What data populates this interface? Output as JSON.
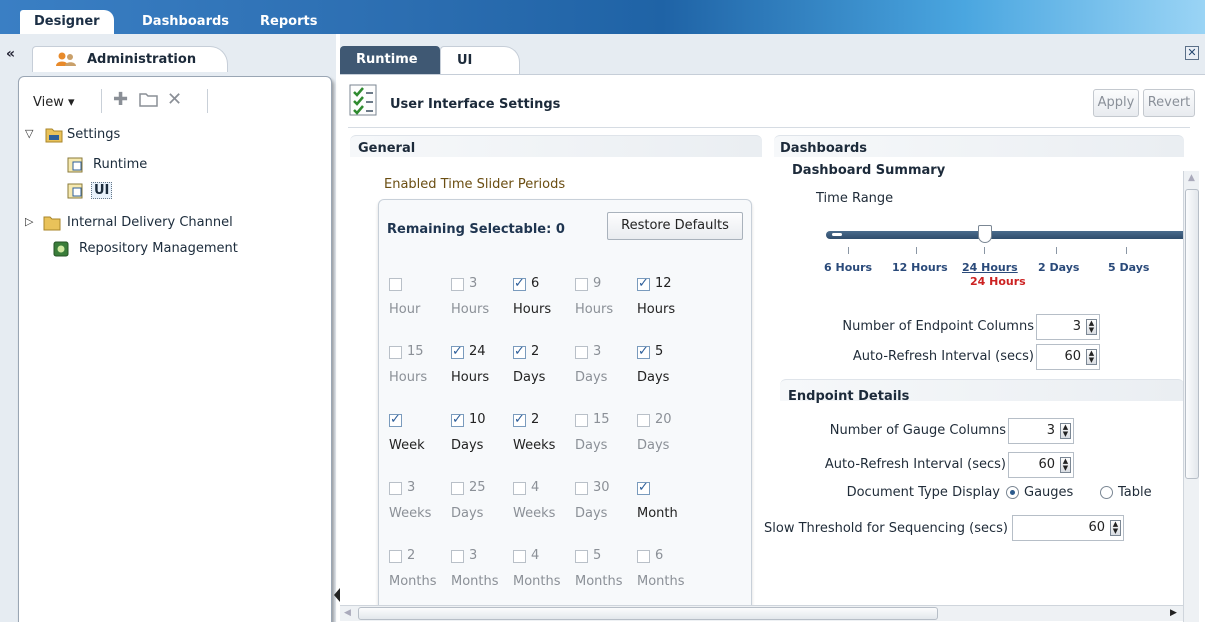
{
  "top_tabs": [
    {
      "label": "Designer",
      "active": true
    },
    {
      "label": "Dashboards",
      "active": false
    },
    {
      "label": "Reports",
      "active": false
    }
  ],
  "left": {
    "collapse_icon": "double-left-chevron",
    "admin_tab": "Administration",
    "toolbar": {
      "view_label": "View ▾"
    },
    "tree": [
      {
        "label": "Settings",
        "expanded": true
      },
      {
        "label": "Runtime"
      },
      {
        "label": "UI",
        "selected": true
      },
      {
        "label": "Internal Delivery Channel",
        "expanded": false
      },
      {
        "label": "Repository Management"
      }
    ]
  },
  "content": {
    "tabs": [
      {
        "label": "Runtime"
      },
      {
        "label": "UI"
      }
    ],
    "page_title": "User Interface Settings",
    "apply_label": "Apply",
    "revert_label": "Revert"
  },
  "general": {
    "title": "General",
    "periods_label": "Enabled Time Slider Periods",
    "remaining": "Remaining Selectable: 0",
    "restore_label": "Restore Defaults",
    "periods": [
      {
        "num": "",
        "unit": "Hour",
        "checked": false
      },
      {
        "num": "3",
        "unit": "Hours",
        "checked": false
      },
      {
        "num": "6",
        "unit": "Hours",
        "checked": true
      },
      {
        "num": "9",
        "unit": "Hours",
        "checked": false
      },
      {
        "num": "12",
        "unit": "Hours",
        "checked": true
      },
      {
        "num": "15",
        "unit": "Hours",
        "checked": false
      },
      {
        "num": "24",
        "unit": "Hours",
        "checked": true
      },
      {
        "num": "2",
        "unit": "Days",
        "checked": true
      },
      {
        "num": "3",
        "unit": "Days",
        "checked": false
      },
      {
        "num": "5",
        "unit": "Days",
        "checked": true
      },
      {
        "num": "",
        "unit": "Week",
        "checked": true
      },
      {
        "num": "10",
        "unit": "Days",
        "checked": true
      },
      {
        "num": "2",
        "unit": "Weeks",
        "checked": true
      },
      {
        "num": "15",
        "unit": "Days",
        "checked": false
      },
      {
        "num": "20",
        "unit": "Days",
        "checked": false
      },
      {
        "num": "3",
        "unit": "Weeks",
        "checked": false
      },
      {
        "num": "25",
        "unit": "Days",
        "checked": false
      },
      {
        "num": "4",
        "unit": "Weeks",
        "checked": false
      },
      {
        "num": "30",
        "unit": "Days",
        "checked": false
      },
      {
        "num": "",
        "unit": "Month",
        "checked": true
      },
      {
        "num": "2",
        "unit": "Months",
        "checked": false
      },
      {
        "num": "3",
        "unit": "Months",
        "checked": false
      },
      {
        "num": "4",
        "unit": "Months",
        "checked": false
      },
      {
        "num": "5",
        "unit": "Months",
        "checked": false
      },
      {
        "num": "6",
        "unit": "Months",
        "checked": false
      }
    ]
  },
  "dashboards": {
    "title": "Dashboards",
    "summary_title": "Dashboard Summary",
    "time_range_label": "Time Range",
    "slider_ticks": [
      "6 Hours",
      "12 Hours",
      "24 Hours",
      "2 Days",
      "5 Days"
    ],
    "slider_selected": "24 Hours",
    "endpoint_cols_label": "Number of Endpoint Columns",
    "endpoint_cols_value": "3",
    "refresh_label": "Auto-Refresh Interval (secs)",
    "refresh_value": "60",
    "endpoint_details_title": "Endpoint Details",
    "gauge_cols_label": "Number of Gauge Columns",
    "gauge_cols_value": "3",
    "refresh2_label": "Auto-Refresh Interval (secs)",
    "refresh2_value": "60",
    "doctype_label": "Document Type Display",
    "doctype_options": [
      "Gauges",
      "Table"
    ],
    "doctype_selected": "Gauges",
    "slow_label": "Slow Threshold for Sequencing (secs)",
    "slow_value": "60"
  },
  "colors": {
    "accent": "#1f63a6",
    "gold_label": "#6b4e12",
    "selected_tick": "#cc2222"
  }
}
